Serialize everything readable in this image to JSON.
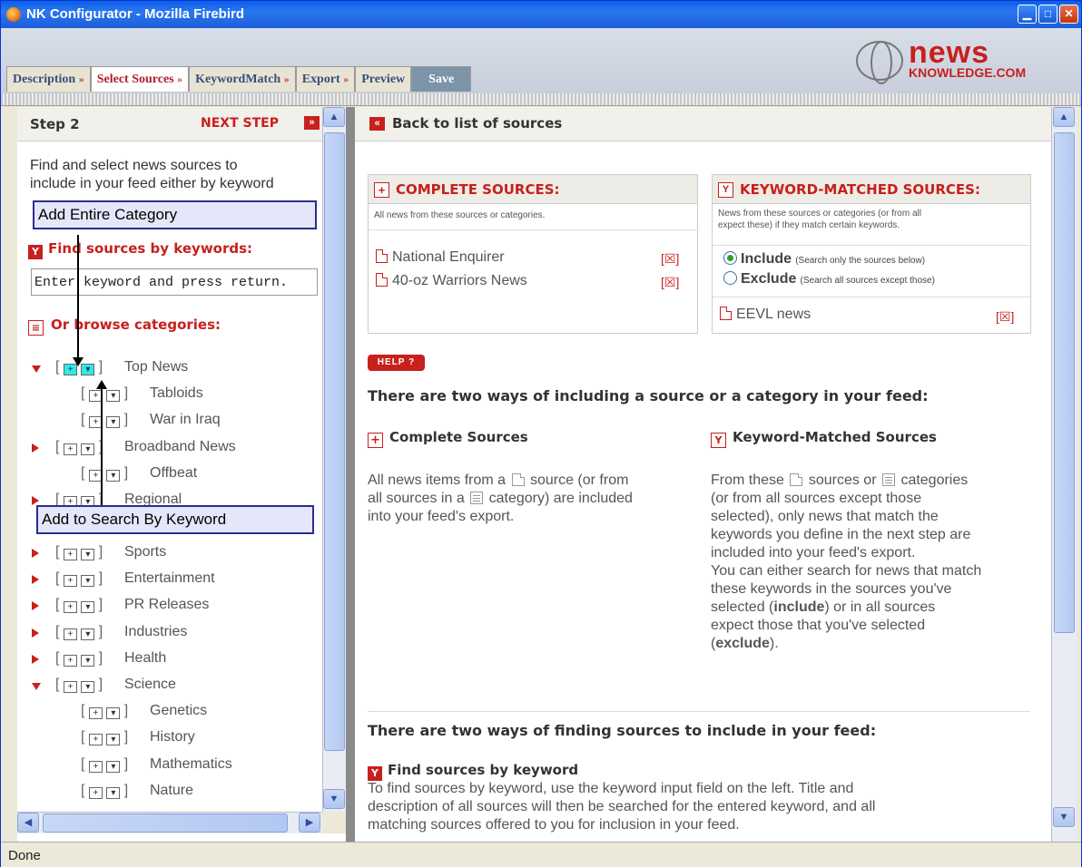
{
  "window": {
    "title": "NK Configurator - Mozilla Firebird"
  },
  "brand": {
    "news": "news",
    "knowledge": "KNOWLEDGE.COM"
  },
  "tabs": [
    {
      "label": "Description",
      "active": false
    },
    {
      "label": "Select Sources",
      "active": true
    },
    {
      "label": "KeywordMatch",
      "active": false
    },
    {
      "label": "Export",
      "active": false
    },
    {
      "label": "Preview",
      "active": false
    },
    {
      "label": "Save",
      "active": false
    }
  ],
  "left": {
    "step": "Step 2",
    "next_step": "NEXT STEP",
    "desc_line1": "Find and select news sources to",
    "desc_line2": "include in your feed either by keyword",
    "find_by_keywords": "Find sources by keywords:",
    "keyword_input_value": "Enter keyword and press return.",
    "browse_categories": "Or browse categories:",
    "categories": [
      {
        "label": "Top News",
        "level": 0,
        "state": "expanded"
      },
      {
        "label": "Tabloids",
        "level": 1,
        "state": "leaf"
      },
      {
        "label": "War in Iraq",
        "level": 1,
        "state": "leaf"
      },
      {
        "label": "Broadband News",
        "level": 0,
        "state": "collapsed"
      },
      {
        "label": "Offbeat",
        "level": 1,
        "state": "leaf"
      },
      {
        "label": "Regional",
        "level": 0,
        "state": "collapsed"
      },
      {
        "label": "Sports",
        "level": 0,
        "state": "collapsed"
      },
      {
        "label": "Entertainment",
        "level": 0,
        "state": "collapsed"
      },
      {
        "label": "PR Releases",
        "level": 0,
        "state": "collapsed"
      },
      {
        "label": "Industries",
        "level": 0,
        "state": "collapsed"
      },
      {
        "label": "Health",
        "level": 0,
        "state": "collapsed"
      },
      {
        "label": "Science",
        "level": 0,
        "state": "expanded"
      },
      {
        "label": "Genetics",
        "level": 1,
        "state": "leaf"
      },
      {
        "label": "History",
        "level": 1,
        "state": "leaf"
      },
      {
        "label": "Mathematics",
        "level": 1,
        "state": "leaf"
      },
      {
        "label": "Nature",
        "level": 1,
        "state": "leaf"
      }
    ]
  },
  "annotations": {
    "add_entire_category": "Add Entire Category",
    "add_to_search_by_keyword": "Add to Search By Keyword"
  },
  "right": {
    "back": "Back to list of sources",
    "complete": {
      "title": "COMPLETE SOURCES:",
      "desc": "All news from these sources or categories.",
      "sources": [
        "National Enquirer",
        "40-oz Warriors News"
      ]
    },
    "keyword": {
      "title": "KEYWORD-MATCHED SOURCES:",
      "desc_line1": "News from these sources or categories (or from all",
      "desc_line2": "expect these) if they match certain keywords.",
      "include_label": "Include",
      "include_hint": "(Search only the sources below)",
      "exclude_label": "Exclude",
      "exclude_hint": "(Search all sources except those)",
      "selected_mode": "include",
      "sources": [
        "EEVL news"
      ]
    },
    "delete_symbol": "[☒]",
    "help": "HELP ?",
    "heading1": "There are two ways of including a source or a category in your feed:",
    "complete_heading": "Complete Sources",
    "complete_p": [
      "All news items from a",
      "source (or from",
      "all sources in a",
      "category) are included",
      "into your feed's export."
    ],
    "kw_heading": "Keyword-Matched Sources",
    "kw_p": [
      "From these",
      "sources or",
      "categories",
      "(or from all sources except those",
      "selected), only news that match the",
      "keywords you define in the next step are",
      "included into your feed's export.",
      "You can either search for news that match",
      "these keywords in the sources you've",
      "selected (",
      "include",
      ") or in all sources",
      "expect those that you've selected",
      "(",
      "exclude",
      ")."
    ],
    "heading2": "There are two ways of finding sources to include in your feed:",
    "find_heading": "Find sources by keyword",
    "find_p1": "To find sources by keyword, use the keyword input field on the left. Title and",
    "find_p2": "description of all sources will then be searched for the entered keyword, and all",
    "find_p3": "matching sources offered to you for inclusion in your feed."
  },
  "status": "Done"
}
